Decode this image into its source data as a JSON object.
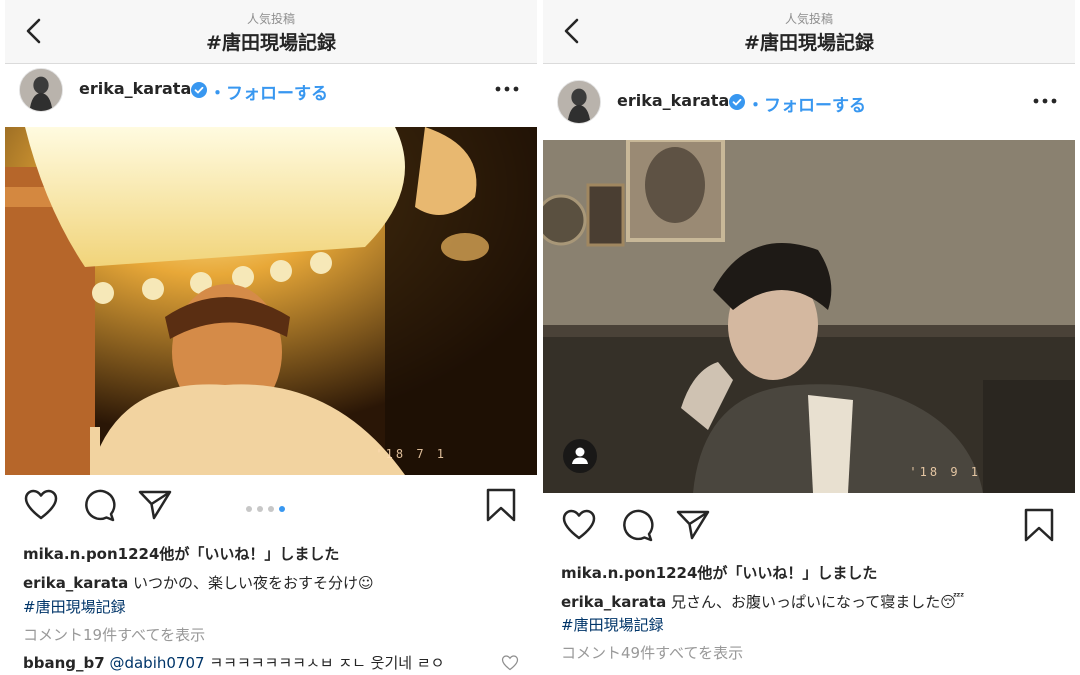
{
  "left": {
    "header": {
      "subtitle": "人気投稿",
      "title": "#唐田現場記録"
    },
    "post": {
      "username": "erika_karata",
      "follow_label": "・フォローする",
      "photo_datestamp": "'18 7 1",
      "carousel": {
        "count": 4,
        "active_index": 3
      },
      "likes_text": "mika.n.pon1224他が「いいね！」しました",
      "caption_user": "erika_karata",
      "caption_text": "いつかの、楽しい夜をおすそ分け☺",
      "hashtag": "#唐田現場記録",
      "view_comments": "コメント19件すべてを表示",
      "comment": {
        "user": "bbang_b7",
        "mention": "@dabih0707",
        "text": "ㅋㅋㅋㅋㅋㅋㅋㅅㅂ ㅈㄴ 웃기네 ㄹㅇ"
      }
    }
  },
  "right": {
    "header": {
      "subtitle": "人気投稿",
      "title": "#唐田現場記録"
    },
    "post": {
      "username": "erika_karata",
      "follow_label": "・フォローする",
      "photo_datestamp": "'18 9 1",
      "likes_text": "mika.n.pon1224他が「いいね！」しました",
      "caption_user": "erika_karata",
      "caption_text": "兄さん、お腹いっぱいになって寝ました😴",
      "hashtag": "#唐田現場記録",
      "view_comments": "コメント49件すべてを表示"
    }
  },
  "colors": {
    "link_blue": "#3897f0",
    "hashtag_navy": "#003569",
    "muted_gray": "#999999"
  },
  "icons": [
    "back-chevron-icon",
    "verified-badge-icon",
    "more-options-icon",
    "heart-icon",
    "comment-icon",
    "share-icon",
    "bookmark-icon",
    "user-tag-icon"
  ]
}
